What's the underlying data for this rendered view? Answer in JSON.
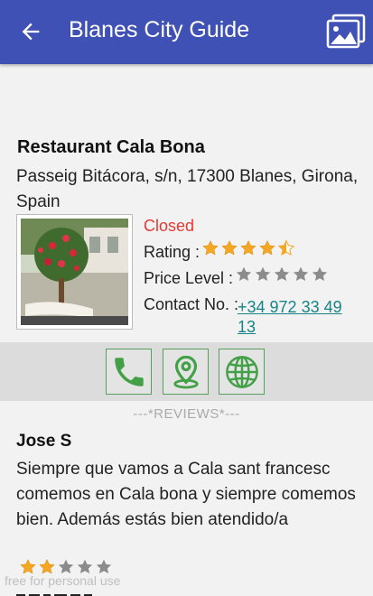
{
  "app_bar": {
    "title": "Blanes City Guide",
    "color": "#3f51b5",
    "back_icon": "arrow-back-icon",
    "gallery_icon": "photo-gallery-icon"
  },
  "place": {
    "name": "Restaurant Cala Bona",
    "address": "Passeig Bitácora, s/n, 17300 Blanes, Girona, Spain",
    "status": "Closed",
    "status_color": "#e53935",
    "rating_label": "Rating :",
    "rating_value": 4.5,
    "rating_max": 5,
    "price_label": "Price Level :",
    "price_value": 0,
    "contact_label": "Contact No. :",
    "contact_phone": "+34 972 33 49 13",
    "photo_icon": "restaurant-photo"
  },
  "actions": [
    {
      "name": "call-button",
      "icon": "phone-icon"
    },
    {
      "name": "map-button",
      "icon": "map-pin-icon"
    },
    {
      "name": "website-button",
      "icon": "globe-icon"
    }
  ],
  "reviews": {
    "title": "---*REVIEWS*---",
    "items": [
      {
        "author": "Jose S",
        "text": "Siempre que vamos a Cala sant francesc comemos en Cala bona y siempre comemos bien. Además estás bien atendido/a",
        "rating": 2,
        "rating_max": 5
      }
    ]
  },
  "watermark": "free for personal use",
  "colors": {
    "star_filled": "#f5a623",
    "star_empty": "#8c8c8c",
    "action_green": "#43a047",
    "link": "#17848a"
  }
}
